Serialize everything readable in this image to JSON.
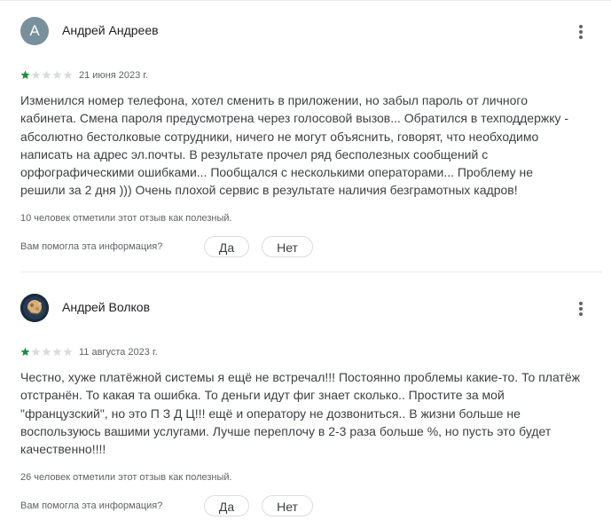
{
  "reviews": [
    {
      "author": "Андрей Андреев",
      "avatar_letter": "А",
      "avatar_color": "#78909c",
      "rating": 1,
      "max_rating": 5,
      "date": "21 июня 2023 г.",
      "text_lines": [
        "Изменился номер телефона, хотел сменить в приложении, но забыл пароль от личного",
        "кабинета. Смена пароля предусмотрена через голосовой вызов... Обратился в техподдержку -",
        "абсолютно бестолковые сотрудники, ничего не могут объяснить, говорят, что необходимо",
        "написать на адрес эл.почты. В результате прочел ряд бесполезных сообщений с",
        "орфографическими ошибками... Пообщался с несколькими операторами... Проблему не",
        "решили за 2 дня ))) Очень плохой сервис в результате наличия безграмотных кадров!"
      ],
      "helpful_count_text": "10 человек отметили этот отзыв как полезный.",
      "helpful_question": "Вам помогла эта информация?",
      "yes_label": "Да",
      "no_label": "Нет"
    },
    {
      "author": "Андрей Волков",
      "avatar_icon": "user-photo-avatar",
      "rating": 1,
      "max_rating": 5,
      "date": "11 августа 2023 г.",
      "text_lines": [
        "Честно, хуже платёжной системы я ещё не встречал!!! Постоянно проблемы какие-то. То платёж",
        "отстранён. То какая та ошибка. То деньги идут фиг знает сколько.. Простите за мой",
        "\"французский\", но это П З Д Ц!!! ещё и оператору не дозвониться.. В жизни больше не",
        "воспользуюсь вашими услугами. Лучше переплочу в 2-3 раза больше %, но пусть это будет",
        "качественно!!!!"
      ],
      "helpful_count_text": "26 человек отметили этот отзыв как полезный.",
      "helpful_question": "Вам помогла эта информация?",
      "yes_label": "Да",
      "no_label": "Нет"
    }
  ],
  "colors": {
    "star_filled": "#1e8e3e",
    "star_empty": "#dadce0",
    "more_icon": "#5f6368"
  },
  "icons": {
    "more": "more-vert-icon",
    "star": "star-icon"
  }
}
